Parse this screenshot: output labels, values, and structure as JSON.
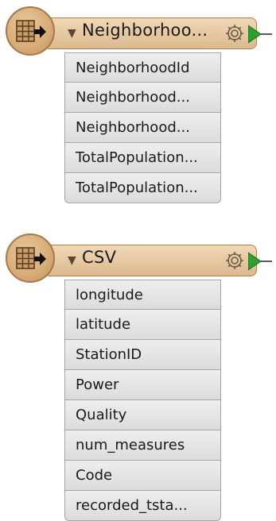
{
  "readers": [
    {
      "title": "Neighborhoo...",
      "attributes": [
        "NeighborhoodId",
        "Neighborhood...",
        "Neighborhood...",
        "TotalPopulation...",
        "TotalPopulation..."
      ]
    },
    {
      "title": "CSV",
      "attributes": [
        "longitude",
        "latitude",
        "StationID",
        "Power",
        "Quality",
        "num_measures",
        "Code",
        "recorded_tsta..."
      ]
    }
  ],
  "icons": {
    "reader_icon": "table-arrow-icon",
    "collapse_icon": "triangle-down-icon",
    "settings_icon": "gear-icon",
    "output_port_icon": "green-arrow-icon"
  },
  "colors": {
    "header_fill": "#dcb98f",
    "header_border": "#a8804f",
    "attribute_fill": "#e4e4e4",
    "output_port": "#2e9e2e"
  }
}
